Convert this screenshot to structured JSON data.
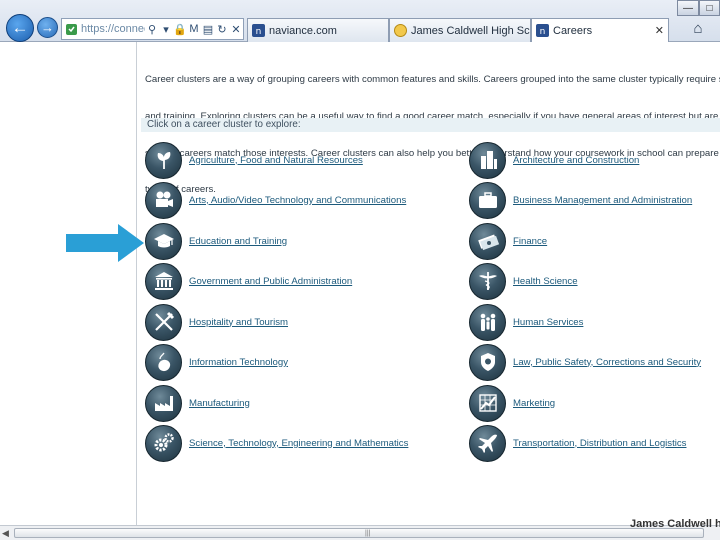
{
  "browser": {
    "address_url": "https://connection",
    "address_letter": "M",
    "tabs": [
      {
        "label": "naviance.com",
        "active": false
      },
      {
        "label": "James Caldwell High School ...",
        "active": false
      },
      {
        "label": "Careers",
        "active": true
      }
    ]
  },
  "page": {
    "intro_lines": [
      "Career clusters are a way of grouping careers with common features and skills. Careers grouped into the same cluster typically require similar ed",
      "and training. Exploring clusters can be a useful way to find a good career match, especially if you have general areas of interest but are not sure v",
      "specific careers match those interests. Career clusters can also help you better understand how your coursework in school can prepare you for c",
      "types of careers."
    ],
    "prompt": "Click on a career cluster to explore:",
    "clusters_left": [
      {
        "label": "Agriculture, Food and Natural Resources",
        "icon": "leaf-icon"
      },
      {
        "label": "Arts, Audio/Video Technology and Communications",
        "icon": "film-camera-icon"
      },
      {
        "label": "Education and Training",
        "icon": "graduation-cap-icon"
      },
      {
        "label": "Government and Public Administration",
        "icon": "capitol-building-icon"
      },
      {
        "label": "Hospitality and Tourism",
        "icon": "fork-knife-icon"
      },
      {
        "label": "Information Technology",
        "icon": "computer-mouse-icon"
      },
      {
        "label": "Manufacturing",
        "icon": "factory-icon"
      },
      {
        "label": "Science, Technology, Engineering and Mathematics",
        "icon": "gears-icon"
      }
    ],
    "clusters_right": [
      {
        "label": "Architecture and Construction",
        "icon": "buildings-icon"
      },
      {
        "label": "Business Management and Administration",
        "icon": "briefcase-icon"
      },
      {
        "label": "Finance",
        "icon": "money-icon"
      },
      {
        "label": "Health Science",
        "icon": "caduceus-icon"
      },
      {
        "label": "Human Services",
        "icon": "people-icon"
      },
      {
        "label": "Law, Public Safety, Corrections and Security",
        "icon": "badge-icon"
      },
      {
        "label": "Marketing",
        "icon": "chart-icon"
      },
      {
        "label": "Transportation, Distribution and Logistics",
        "icon": "airplane-icon"
      }
    ],
    "footer_peek": "James Caldwell h"
  },
  "colors": {
    "arrow": "#2a9fd6",
    "link": "#1c5a7c",
    "prompt_bar": "#e8f1f5"
  }
}
